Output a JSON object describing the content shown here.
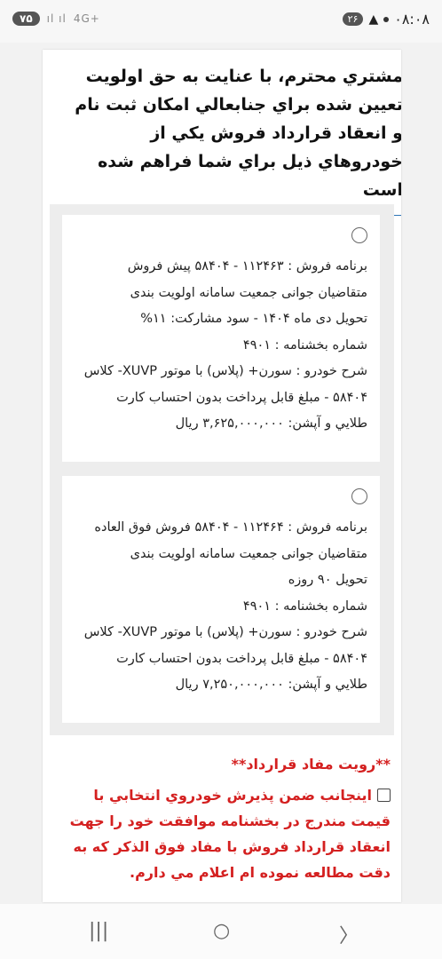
{
  "status_bar": {
    "time": "۰۸:۰۸",
    "notification_count": "۲۶",
    "battery": "۷۵",
    "network": "4G+"
  },
  "intro_text": "مشتري محترم، با عنايت به حق اولويت تعيين شده براي جنابعالي امكان ثبت نام و انعقاد قرارداد فروش يكي از خودروهاي ذيل براي شما فراهم شده است",
  "options": [
    {
      "lines": [
        "برنامه فروش : ۱۱۲۴۶۳ - ۵۸۴۰۴ پیش فروش",
        "متقاضیان جوانی جمعیت سامانه اولویت بندی",
        "تحويل دی ماه ۱۴۰۴ - سود مشارکت: ۱۱%",
        "شماره بخشنامه : ۴۹۰۱",
        "شرح خودرو : سورن+ (پلاس) با موتور XUVP- کلاس",
        "۵۸۴۰۴ - مبلغ قابل پرداخت بدون احتساب کارت",
        "طلايي و آپشن: ۳,۶۲۵,۰۰۰,۰۰۰ ريال"
      ]
    },
    {
      "lines": [
        "برنامه فروش : ۱۱۲۴۶۴ - ۵۸۴۰۴ فروش فوق العاده",
        "متقاضیان جوانی جمعیت سامانه اولویت بندی",
        "تحويل ۹۰ روزه",
        "شماره بخشنامه : ۴۹۰۱",
        "شرح خودرو : سورن+ (پلاس) با موتور XUVP- کلاس",
        "۵۸۴۰۴ - مبلغ قابل پرداخت بدون احتساب کارت",
        "طلايي و آپشن: ۷,۲۵۰,۰۰۰,۰۰۰ ريال"
      ]
    }
  ],
  "agreement": {
    "title": "**رويت مفاد قرارداد**",
    "text": "اينجانب ضمن پذيرش خودروي انتخابي با قيمت مندرج در بخشنامه موافقت خود را جهت انعقاد قرارداد فروش با مفاد فوق الذكر كه به دقت مطالعه نموده ام اعلام مي دارم."
  },
  "nav_bar": {
    "recents": "|||",
    "home": "○",
    "back": "〉"
  }
}
